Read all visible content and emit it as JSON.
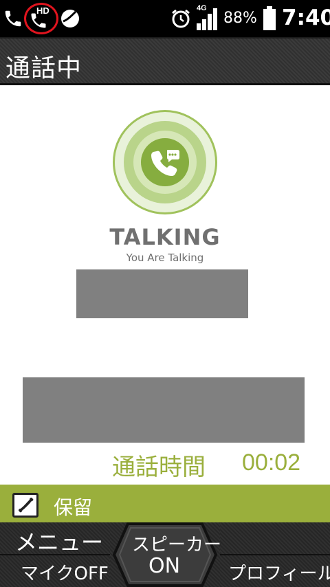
{
  "status_bar": {
    "hd_label": "HD",
    "network_label": "4G",
    "battery_percent": "88%",
    "clock": "7:40",
    "icons": [
      "phone-icon",
      "hd-call-icon",
      "app-icon",
      "alarm-icon",
      "signal-icon",
      "battery-icon"
    ]
  },
  "title_bar": {
    "title": "通話中"
  },
  "call_status": {
    "icon": "phone-chat-icon",
    "status": "TALKING",
    "subtitle": "You Are Talking"
  },
  "duration": {
    "label": "通話時間",
    "value": "00:02"
  },
  "hold": {
    "icon": "handset-icon",
    "label": "保留"
  },
  "softkeys": {
    "menu": "メニュー",
    "mic_off": "マイクOFF",
    "speaker_line1": "スピーカー",
    "speaker_line2": "ON",
    "profile": "プロフィール"
  },
  "colors": {
    "accent_green": "#9aaf3c",
    "hd_circle_red": "#e0141e"
  }
}
